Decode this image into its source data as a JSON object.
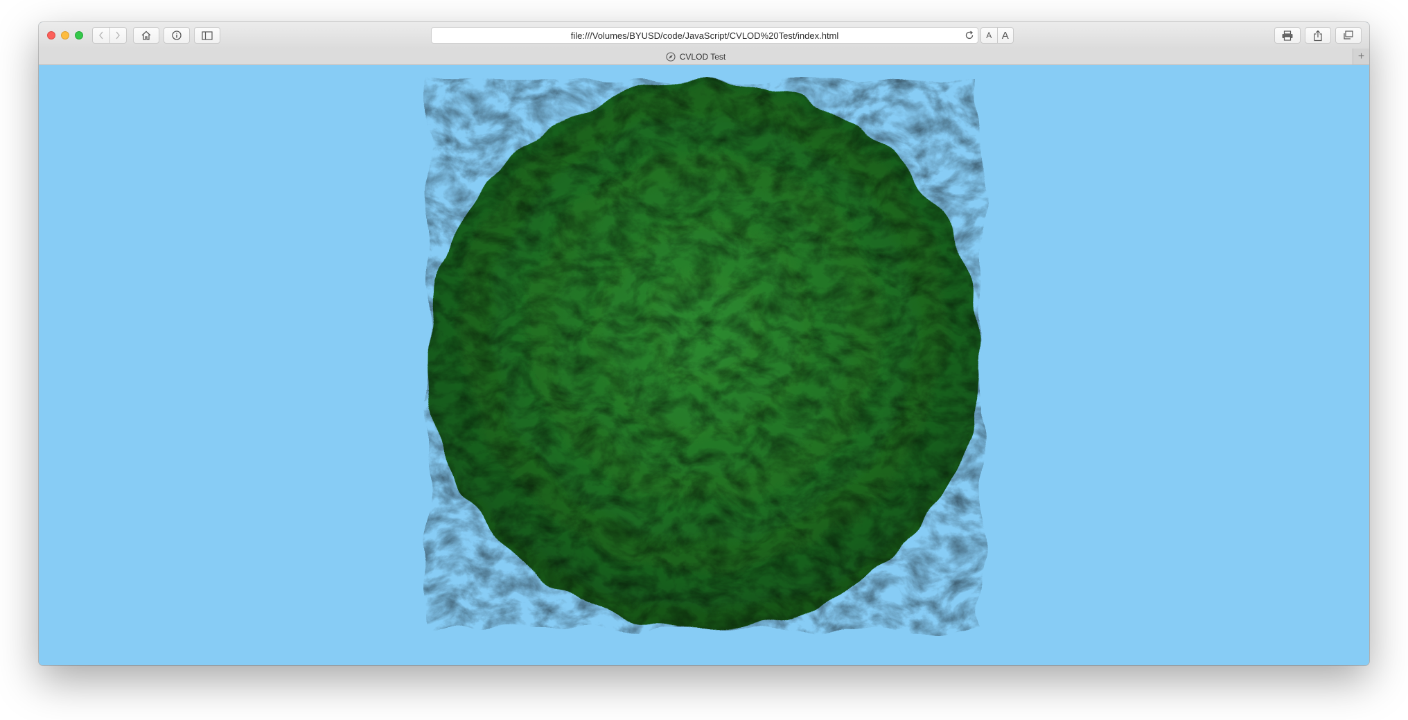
{
  "browser": {
    "url": "file:///Volumes/BYUSD/code/JavaScript/CVLOD%20Test/index.html",
    "tab_title": "CVLOD Test",
    "font_small_label": "A",
    "font_large_label": "A",
    "new_tab_label": "+"
  },
  "colors": {
    "sky": "#87ccf5",
    "terrain": "#1f6e22",
    "terrain_dark": "#145418",
    "terrain_light": "#2d8a30"
  },
  "icons": {
    "back": "chevron-left-icon",
    "forward": "chevron-right-icon",
    "home": "home-icon",
    "info": "info-icon",
    "sidebar": "sidebar-icon",
    "reload": "reload-icon",
    "print": "printer-icon",
    "share": "share-icon",
    "tabs": "tabs-overview-icon",
    "tab_favicon": "compass-icon"
  }
}
